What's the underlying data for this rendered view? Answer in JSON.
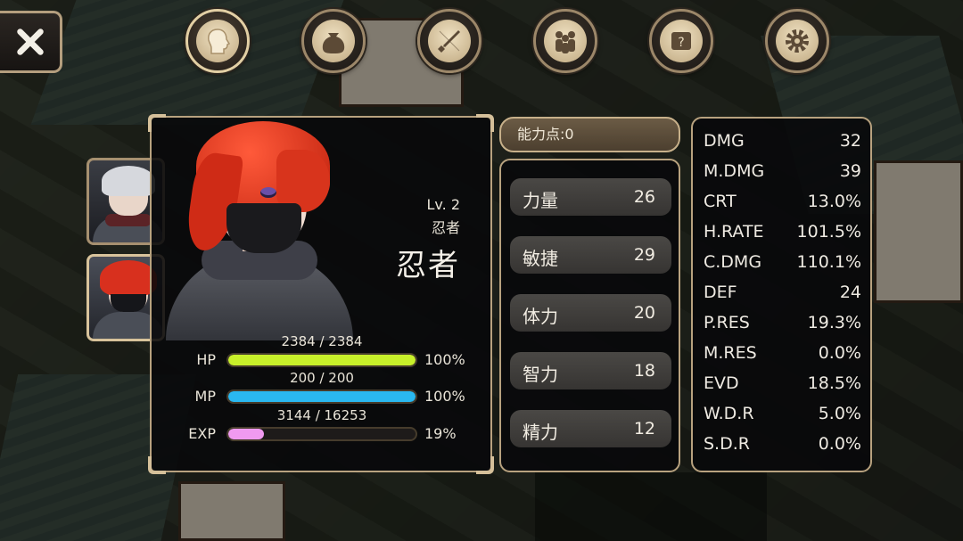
{
  "nav": {
    "close_icon": "close-icon",
    "tabs": [
      {
        "icon": "character-head-icon",
        "active": true
      },
      {
        "icon": "bag-icon",
        "active": false
      },
      {
        "icon": "skill-icon",
        "active": false
      },
      {
        "icon": "party-icon",
        "active": false
      },
      {
        "icon": "quest-scroll-icon",
        "active": false
      },
      {
        "icon": "settings-gear-icon",
        "active": false
      }
    ]
  },
  "party": [
    {
      "name": "white-haired-hero",
      "selected": false
    },
    {
      "name": "red-haired-ninja",
      "selected": true
    }
  ],
  "character": {
    "level": "Lv. 2",
    "job_small": "忍者",
    "job_big": "忍者",
    "hp": {
      "label": "HP",
      "value": "2384 / 2384",
      "percent_text": "100%",
      "fill": 1.0,
      "color": "#c8f02a"
    },
    "mp": {
      "label": "MP",
      "value": "200 / 200",
      "percent_text": "100%",
      "fill": 1.0,
      "color": "#2ab8f0"
    },
    "exp": {
      "label": "EXP",
      "value": "3144 / 16253",
      "percent_text": "19%",
      "fill": 0.19,
      "color": "#f09af0"
    }
  },
  "ability_points": "能力点:0",
  "attributes": [
    {
      "name": "力量",
      "value": "26"
    },
    {
      "name": "敏捷",
      "value": "29"
    },
    {
      "name": "体力",
      "value": "20"
    },
    {
      "name": "智力",
      "value": "18"
    },
    {
      "name": "精力",
      "value": "12"
    }
  ],
  "stats": [
    {
      "name": "DMG",
      "value": "32"
    },
    {
      "name": "M.DMG",
      "value": "39"
    },
    {
      "name": "CRT",
      "value": "13.0%"
    },
    {
      "name": "H.RATE",
      "value": "101.5%"
    },
    {
      "name": "C.DMG",
      "value": "110.1%"
    },
    {
      "name": "DEF",
      "value": "24"
    },
    {
      "name": "P.RES",
      "value": "19.3%"
    },
    {
      "name": "M.RES",
      "value": "0.0%"
    },
    {
      "name": "EVD",
      "value": "18.5%"
    },
    {
      "name": "W.D.R",
      "value": "5.0%"
    },
    {
      "name": "S.D.R",
      "value": "0.0%"
    }
  ]
}
